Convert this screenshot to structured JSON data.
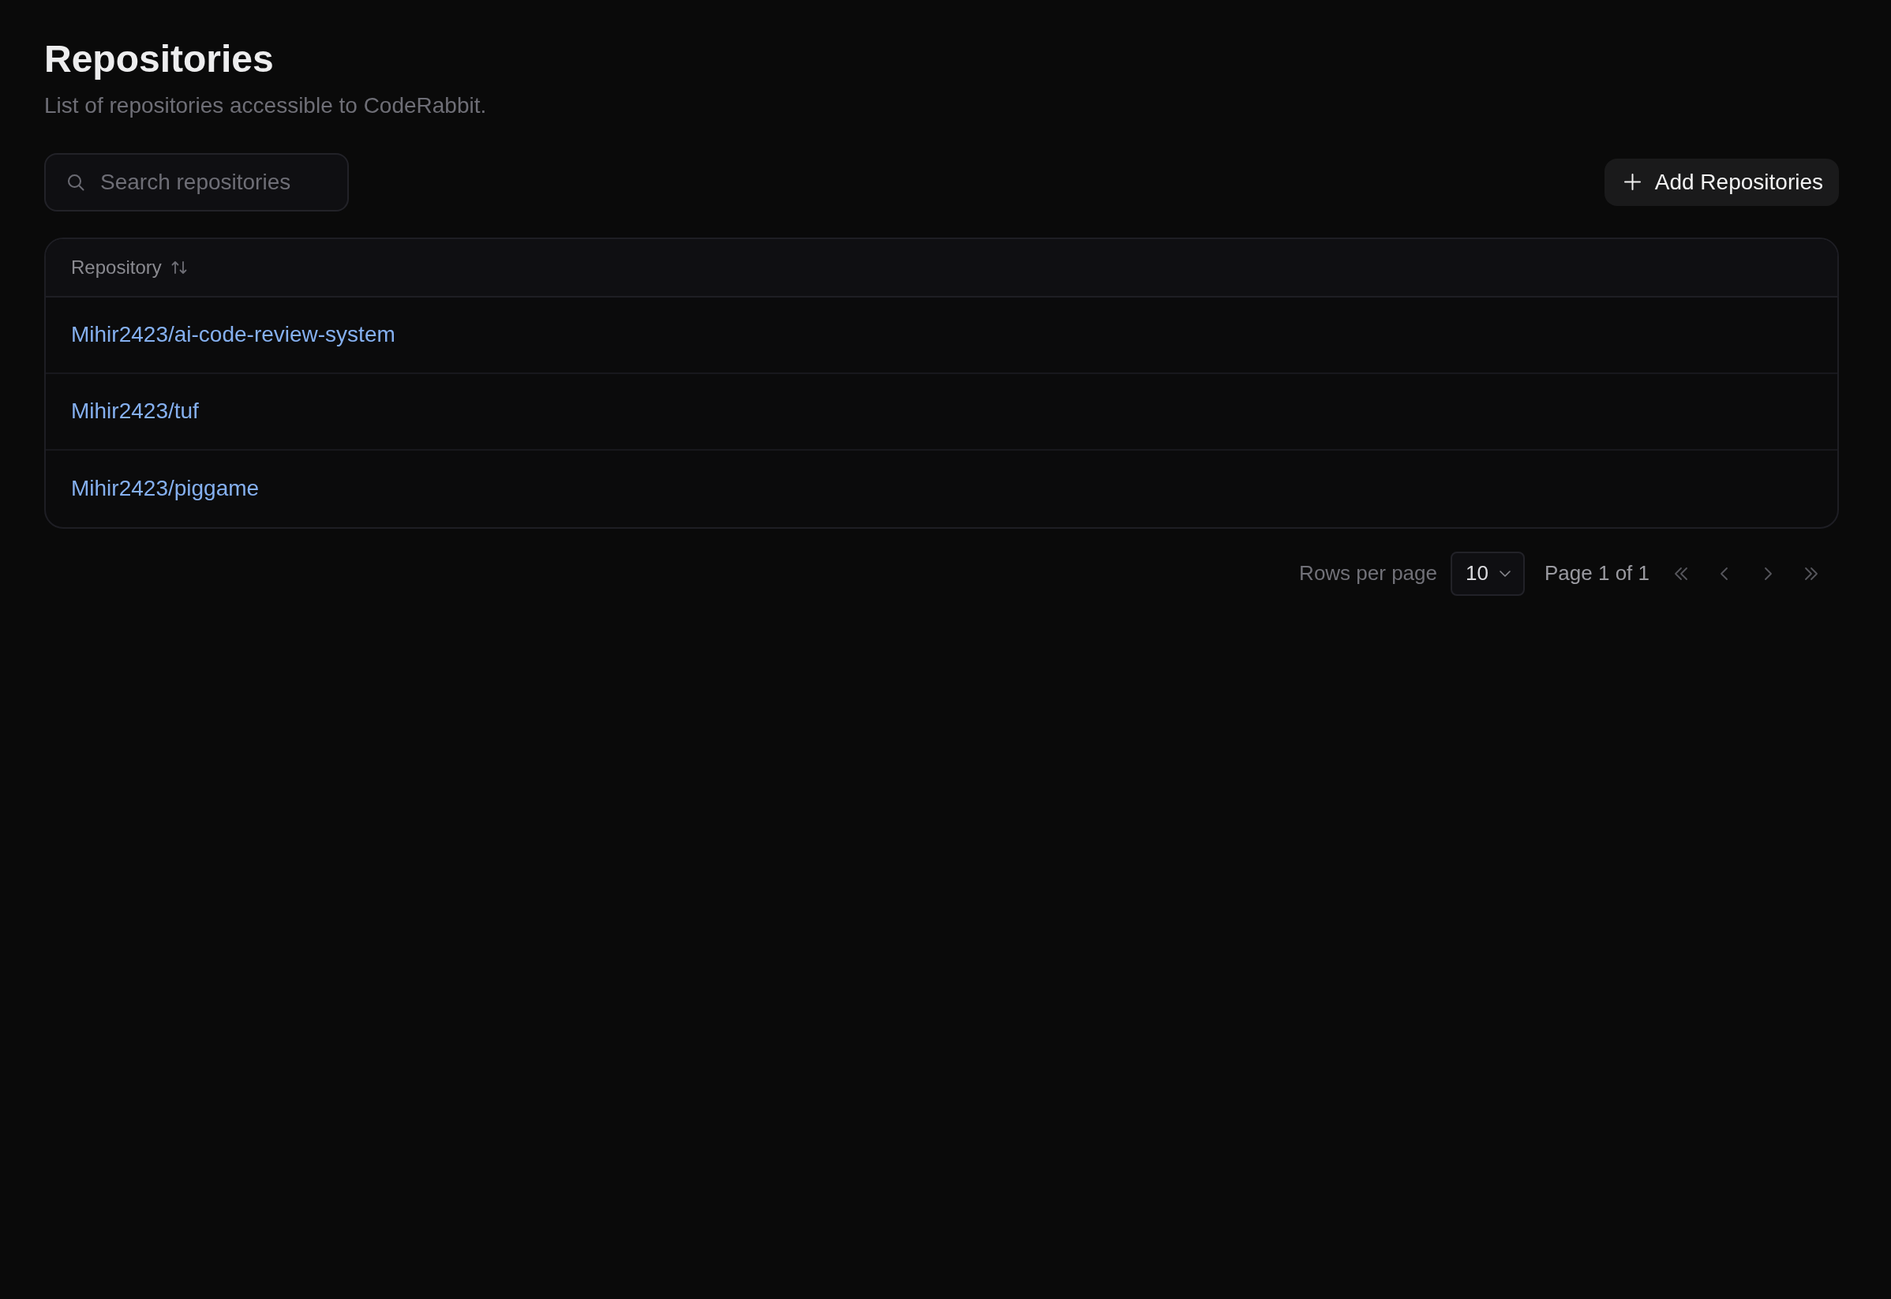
{
  "header": {
    "title": "Repositories",
    "subtitle": "List of repositories accessible to CodeRabbit."
  },
  "search": {
    "placeholder": "Search repositories"
  },
  "add_button": {
    "label": "Add Repositories"
  },
  "table": {
    "columns": [
      {
        "label": "Repository",
        "sortable": true
      }
    ],
    "rows": [
      {
        "repository": "Mihir2423/ai-code-review-system"
      },
      {
        "repository": "Mihir2423/tuf"
      },
      {
        "repository": "Mihir2423/piggame"
      }
    ]
  },
  "pagination": {
    "rows_per_page_label": "Rows per page",
    "rows_per_page": "10",
    "page_info": "Page 1 of 1",
    "buttons": [
      {
        "kind": "first",
        "disabled": true
      },
      {
        "kind": "previous",
        "disabled": true
      },
      {
        "kind": "next",
        "disabled": true
      },
      {
        "kind": "last",
        "disabled": true
      }
    ]
  }
}
